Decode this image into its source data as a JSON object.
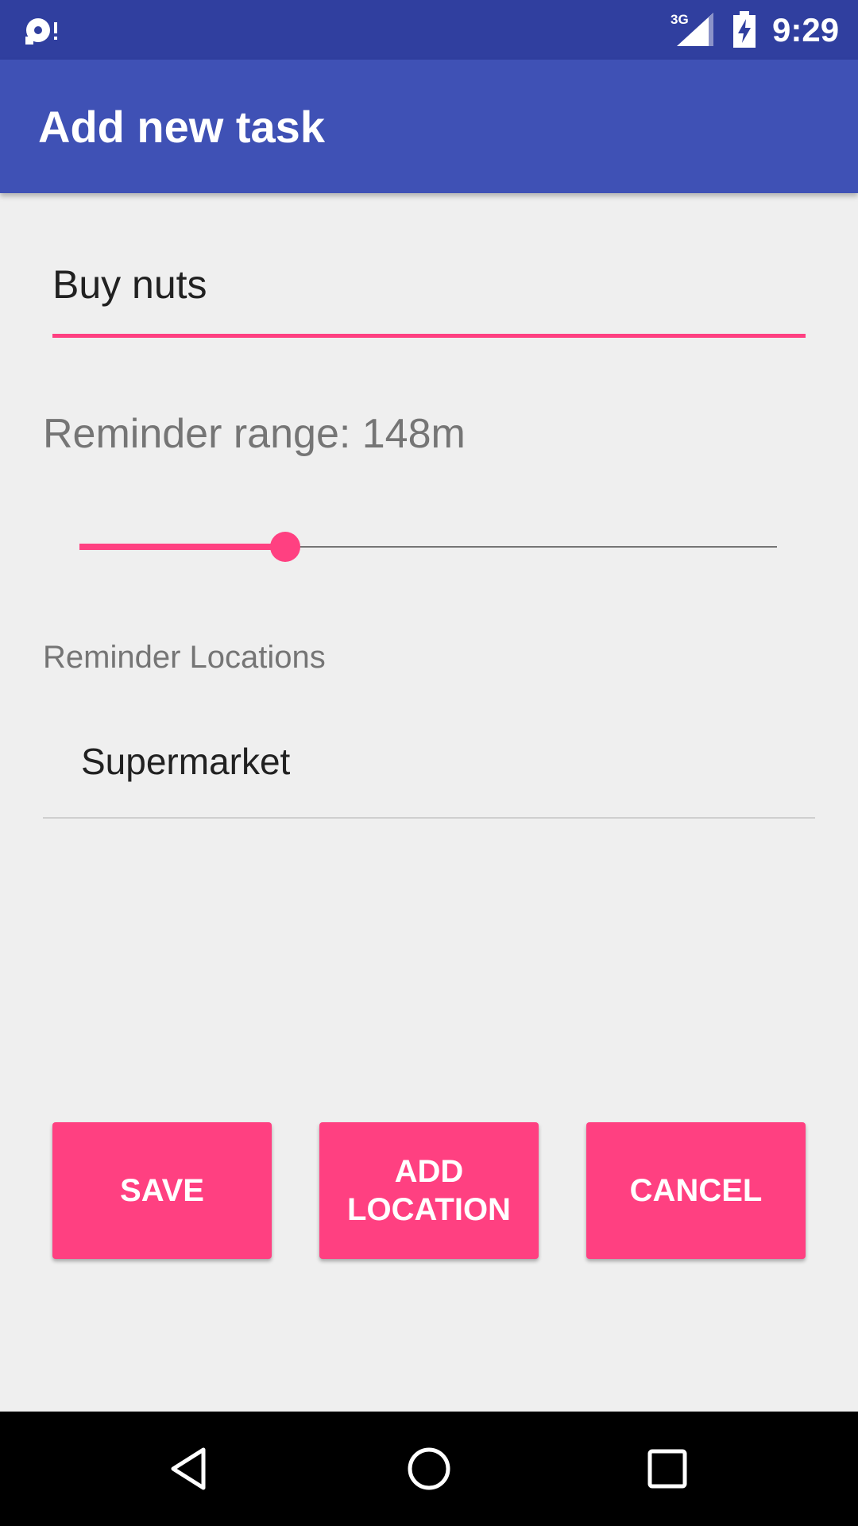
{
  "status_bar": {
    "time": "9:29",
    "network_label": "3G",
    "icons": [
      "notification-icon",
      "signal-icon",
      "battery-charging-icon"
    ]
  },
  "toolbar": {
    "title": "Add new task"
  },
  "task": {
    "name_value": "Buy nuts"
  },
  "range": {
    "label": "Reminder range: 148m",
    "slider_fraction": 0.295
  },
  "locations": {
    "header": "Reminder Locations",
    "items": [
      "Supermarket"
    ]
  },
  "buttons": {
    "save": "SAVE",
    "add_location": "ADD\nLOCATION",
    "cancel": "CANCEL"
  },
  "nav_bar": {
    "icons": [
      "back-icon",
      "home-icon",
      "recents-icon"
    ]
  },
  "colors": {
    "primary": "#3f51b5",
    "primary_dark": "#303f9f",
    "accent": "#ff4081",
    "background": "#efefef"
  }
}
